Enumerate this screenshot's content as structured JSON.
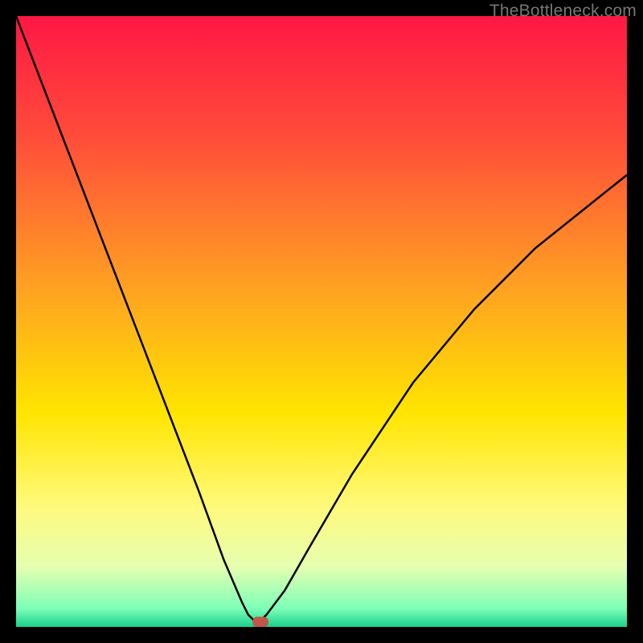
{
  "watermark": "TheBottleneck.com",
  "chart_data": {
    "type": "line",
    "title": "",
    "xlabel": "",
    "ylabel": "",
    "xlim": [
      0,
      100
    ],
    "ylim": [
      0,
      100
    ],
    "background": {
      "type": "vertical-gradient",
      "stops": [
        {
          "offset": 0,
          "color": "#ff1744"
        },
        {
          "offset": 20,
          "color": "#ff4d3a"
        },
        {
          "offset": 45,
          "color": "#ffa321"
        },
        {
          "offset": 65,
          "color": "#ffe500"
        },
        {
          "offset": 80,
          "color": "#fff97a"
        },
        {
          "offset": 90,
          "color": "#e7ffb0"
        },
        {
          "offset": 97,
          "color": "#7dffb7"
        },
        {
          "offset": 100,
          "color": "#18d18d"
        }
      ]
    },
    "series": [
      {
        "name": "bottleneck-curve",
        "color": "#000000",
        "x": [
          0,
          5,
          10,
          15,
          20,
          25,
          30,
          34,
          37,
          38,
          39,
          40,
          41,
          44,
          48,
          55,
          65,
          75,
          85,
          95,
          100
        ],
        "values": [
          100,
          87,
          74,
          61,
          48,
          35,
          22,
          11,
          4,
          2,
          1,
          1,
          2,
          6,
          13,
          25,
          40,
          52,
          62,
          70,
          74
        ]
      }
    ],
    "marker": {
      "name": "optimum-point",
      "x": 40,
      "y": 0.8,
      "color": "#c0574a",
      "shape": "rounded-rect"
    }
  }
}
